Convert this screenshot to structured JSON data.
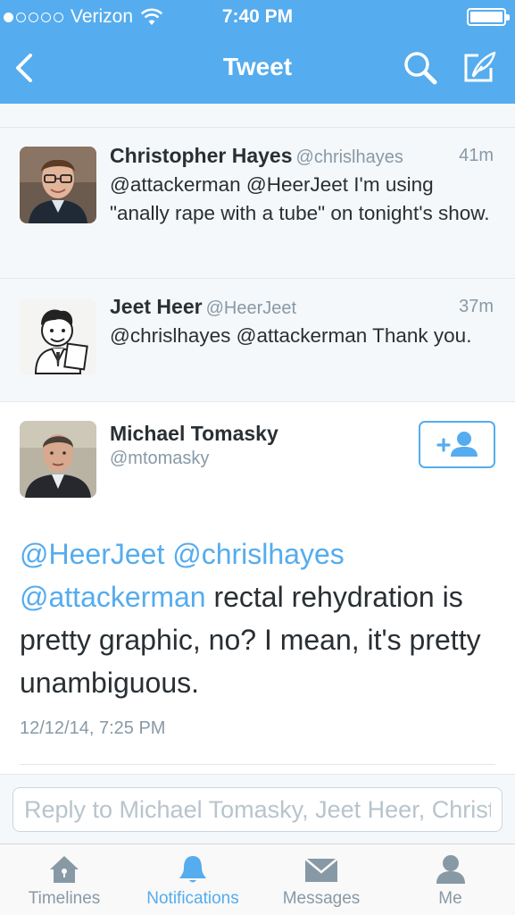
{
  "status_bar": {
    "carrier": "Verizon",
    "time": "7:40 PM",
    "signal_bars_filled": 1,
    "signal_bars_total": 5
  },
  "nav": {
    "title": "Tweet",
    "back_icon": "chevron-left-icon",
    "search_icon": "search-icon",
    "compose_icon": "compose-icon"
  },
  "replies": [
    {
      "name": "Christopher Hayes",
      "handle": "@chrislhayes",
      "time": "41m",
      "text": "@attackerman @HeerJeet I'm using \"anally rape with a tube\" on tonight's show."
    },
    {
      "name": "Jeet Heer",
      "handle": "@HeerJeet",
      "time": "37m",
      "text": "@chrislhayes @attackerman Thank you."
    }
  ],
  "main_tweet": {
    "name": "Michael Tomasky",
    "handle": "@mtomasky",
    "mention_1": "@HeerJeet",
    "mention_2": "@chrislhayes",
    "mention_3": "@attackerman",
    "text_rest": " rectal rehydration is pretty graphic, no? I mean, it's pretty unambiguous.",
    "date": "12/12/14, 7:25 PM",
    "follow_icon": "add-user-icon"
  },
  "reply_box": {
    "placeholder": "Reply to Michael Tomasky, Jeet Heer, Christopher Hayes"
  },
  "tabs": [
    {
      "label": "Timelines",
      "icon": "home-icon",
      "active": false
    },
    {
      "label": "Notifications",
      "icon": "bell-icon",
      "active": true
    },
    {
      "label": "Messages",
      "icon": "envelope-icon",
      "active": false
    },
    {
      "label": "Me",
      "icon": "person-icon",
      "active": false
    }
  ],
  "colors": {
    "brand_blue": "#55acee",
    "text_dark": "#292f33",
    "text_gray": "#8899a6",
    "light_bg": "#f5f8fa"
  }
}
